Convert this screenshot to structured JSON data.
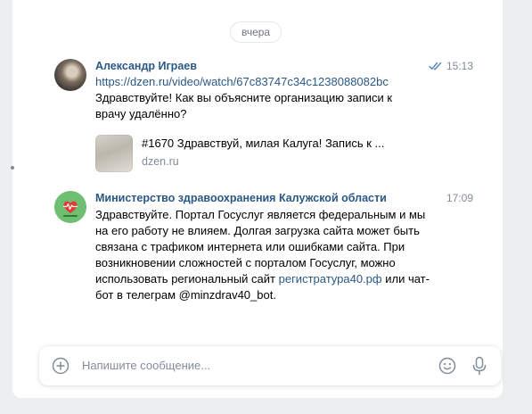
{
  "chat": {
    "date_separator": "вчера",
    "messages": [
      {
        "author": "Александр Играев",
        "time": "15:13",
        "status_icon": "double-check-icon",
        "link": "https://dzen.ru/video/watch/67c83747c34c1238088082bc",
        "text": "Здравствуйте! Как вы объясните организацию записи к врачу удалённо?",
        "attachment": {
          "title": "#1670 Здравствуй, милая Калуга! Запись к ...",
          "domain": "dzen.ru"
        }
      },
      {
        "author": "Министерство здравоохранения Калужской области",
        "time": "17:09",
        "text_before_link": "Здравствуйте. Портал Госуслуг является федеральным и мы на его работу не влияем. Долгая загрузка сайта может быть связана с трафиком интернета или ошибками сайта. При возникновении сложностей с порталом Госуслуг, можно использовать региональный сайт ",
        "link": "регистратура40.рф",
        "text_after_link": " или чат-бот в телеграм @minzdrav40_bot."
      }
    ]
  },
  "composer": {
    "placeholder": "Напишите сообщение..."
  },
  "colors": {
    "link": "#2a5885",
    "muted": "#818c99",
    "background": "#edeef0",
    "read_check": "#5181b8"
  }
}
